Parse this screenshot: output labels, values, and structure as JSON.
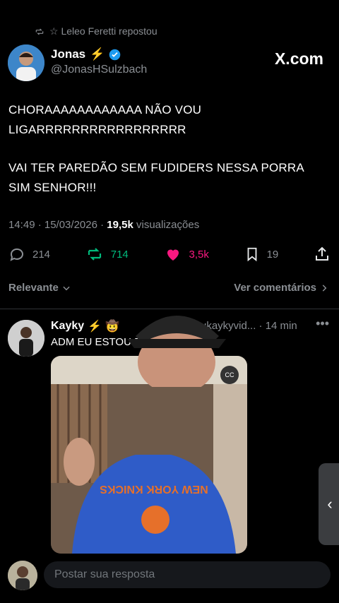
{
  "repost_banner": {
    "text": "☆ Leleo Feretti repostou"
  },
  "author": {
    "name": "Jonas",
    "emoji": "⚡",
    "handle": "@JonasHSulzbach"
  },
  "watermark": "X.com",
  "tweet": {
    "line1": "CHORAAAAAAAAAAAA NÃO VOU",
    "line2": "LIGARRRRRRRRRRRRRRRRR",
    "line3": "VAI TER PAREDÃO SEM FUDIDERS NESSA PORRA",
    "line4": "SIM SENHOR!!!"
  },
  "meta": {
    "time_date": "14:49 · 15/03/2026 · ",
    "views_count": "19,5k",
    "views_label": " visualizações"
  },
  "actions": {
    "replies": "214",
    "reposts": "714",
    "likes": "3,5k",
    "bookmarks": "19"
  },
  "sort": {
    "label": "Relevante",
    "more": "Ver comentários"
  },
  "reply": {
    "name": "Kayky",
    "emoji": "⚡",
    "meta": "ukaykyvid... · 14 min",
    "text": "ADM EU ESTOU FELIZ",
    "video_shirt_text": "NEW YORK KNICKS",
    "cc_label": "CC"
  },
  "composer": {
    "placeholder": "Postar sua resposta"
  },
  "colors": {
    "accent_blue": "#1d9bf0",
    "repost_green": "#00ba7c",
    "like_pink": "#f91880",
    "muted": "#8b8f94"
  }
}
